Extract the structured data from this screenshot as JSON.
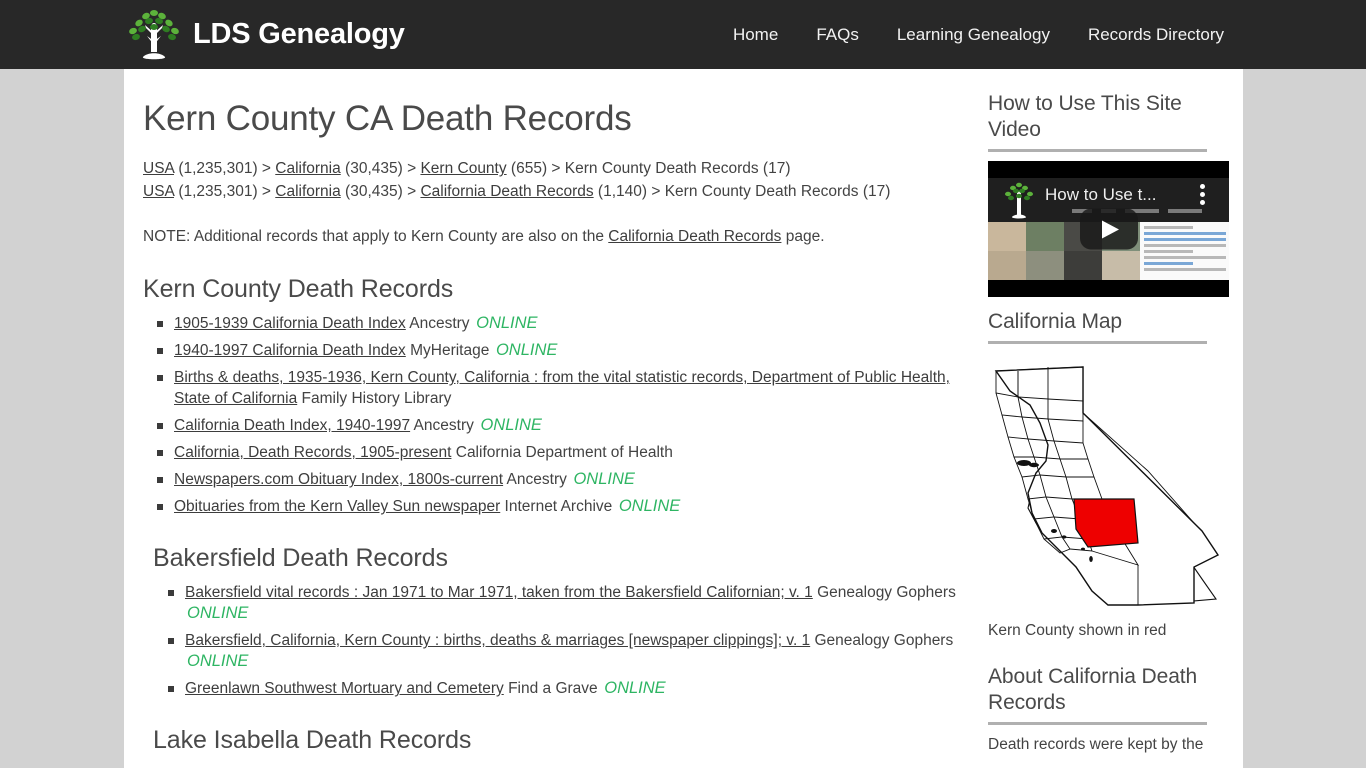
{
  "header": {
    "brand": "LDS Genealogy",
    "logo_icon": "tree-logo-icon",
    "nav": [
      {
        "label": "Home",
        "name": "nav-home"
      },
      {
        "label": "FAQs",
        "name": "nav-faqs"
      },
      {
        "label": "Learning Genealogy",
        "name": "nav-learning-genealogy"
      },
      {
        "label": "Records Directory",
        "name": "nav-records-directory"
      }
    ]
  },
  "main": {
    "page_title": "Kern County CA Death Records",
    "breadcrumbs": [
      {
        "parts": [
          {
            "text": "USA",
            "link": true
          },
          {
            "text": " (1,235,301) > ",
            "link": false
          },
          {
            "text": "California",
            "link": true
          },
          {
            "text": " (30,435) > ",
            "link": false
          },
          {
            "text": "Kern County",
            "link": true
          },
          {
            "text": " (655) > Kern County Death Records (17)",
            "link": false
          }
        ]
      },
      {
        "parts": [
          {
            "text": "USA",
            "link": true
          },
          {
            "text": " (1,235,301) > ",
            "link": false
          },
          {
            "text": "California",
            "link": true
          },
          {
            "text": " (30,435) > ",
            "link": false
          },
          {
            "text": "California Death Records",
            "link": true
          },
          {
            "text": " (1,140) > Kern County Death Records (17)",
            "link": false
          }
        ]
      }
    ],
    "note": {
      "before": "NOTE: Additional records that apply to Kern County are also on the ",
      "link": "California Death Records",
      "after": " page."
    },
    "sections": [
      {
        "title": "Kern County Death Records",
        "indented": false,
        "items": [
          {
            "title": "1905-1939 California Death Index",
            "provider": "Ancestry",
            "online": "ONLINE"
          },
          {
            "title": "1940-1997 California Death Index",
            "provider": "MyHeritage",
            "online": "ONLINE"
          },
          {
            "title": "Births & deaths, 1935-1936, Kern County, California : from the vital statistic records, Department of Public Health, State of California",
            "provider": "Family History Library",
            "online": ""
          },
          {
            "title": "California Death Index, 1940-1997",
            "provider": "Ancestry",
            "online": "ONLINE"
          },
          {
            "title": "California, Death Records, 1905-present",
            "provider": "California Department of Health",
            "online": ""
          },
          {
            "title": "Newspapers.com Obituary Index, 1800s-current",
            "provider": "Ancestry",
            "online": "ONLINE"
          },
          {
            "title": "Obituaries from the Kern Valley Sun newspaper",
            "provider": "Internet Archive",
            "online": "ONLINE"
          }
        ]
      },
      {
        "title": "Bakersfield Death Records",
        "indented": true,
        "items": [
          {
            "title": "Bakersfield vital records : Jan 1971 to Mar 1971, taken from the Bakersfield Californian; v. 1",
            "provider": "Genealogy Gophers",
            "online": "ONLINE"
          },
          {
            "title": "Bakersfield, California, Kern County : births, deaths & marriages [newspaper clippings]; v. 1",
            "provider": "Genealogy Gophers",
            "online": "ONLINE"
          },
          {
            "title": "Greenlawn Southwest Mortuary and Cemetery",
            "provider": "Find a Grave",
            "online": "ONLINE"
          }
        ]
      },
      {
        "title": "Lake Isabella Death Records",
        "indented": true,
        "items": []
      }
    ]
  },
  "sidebar": {
    "video": {
      "heading": "How to Use This Site Video",
      "thumbnail_title": "How to Use t...",
      "play_icon": "play-icon",
      "kebab_icon": "kebab-menu-icon",
      "logo_icon": "tree-logo-icon"
    },
    "map": {
      "heading": "California Map",
      "caption": "Kern County shown in red",
      "highlight_color": "#ee0000",
      "icon": "california-map-icon"
    },
    "about": {
      "heading": "About California Death Records",
      "text": "Death records were kept by the"
    }
  }
}
